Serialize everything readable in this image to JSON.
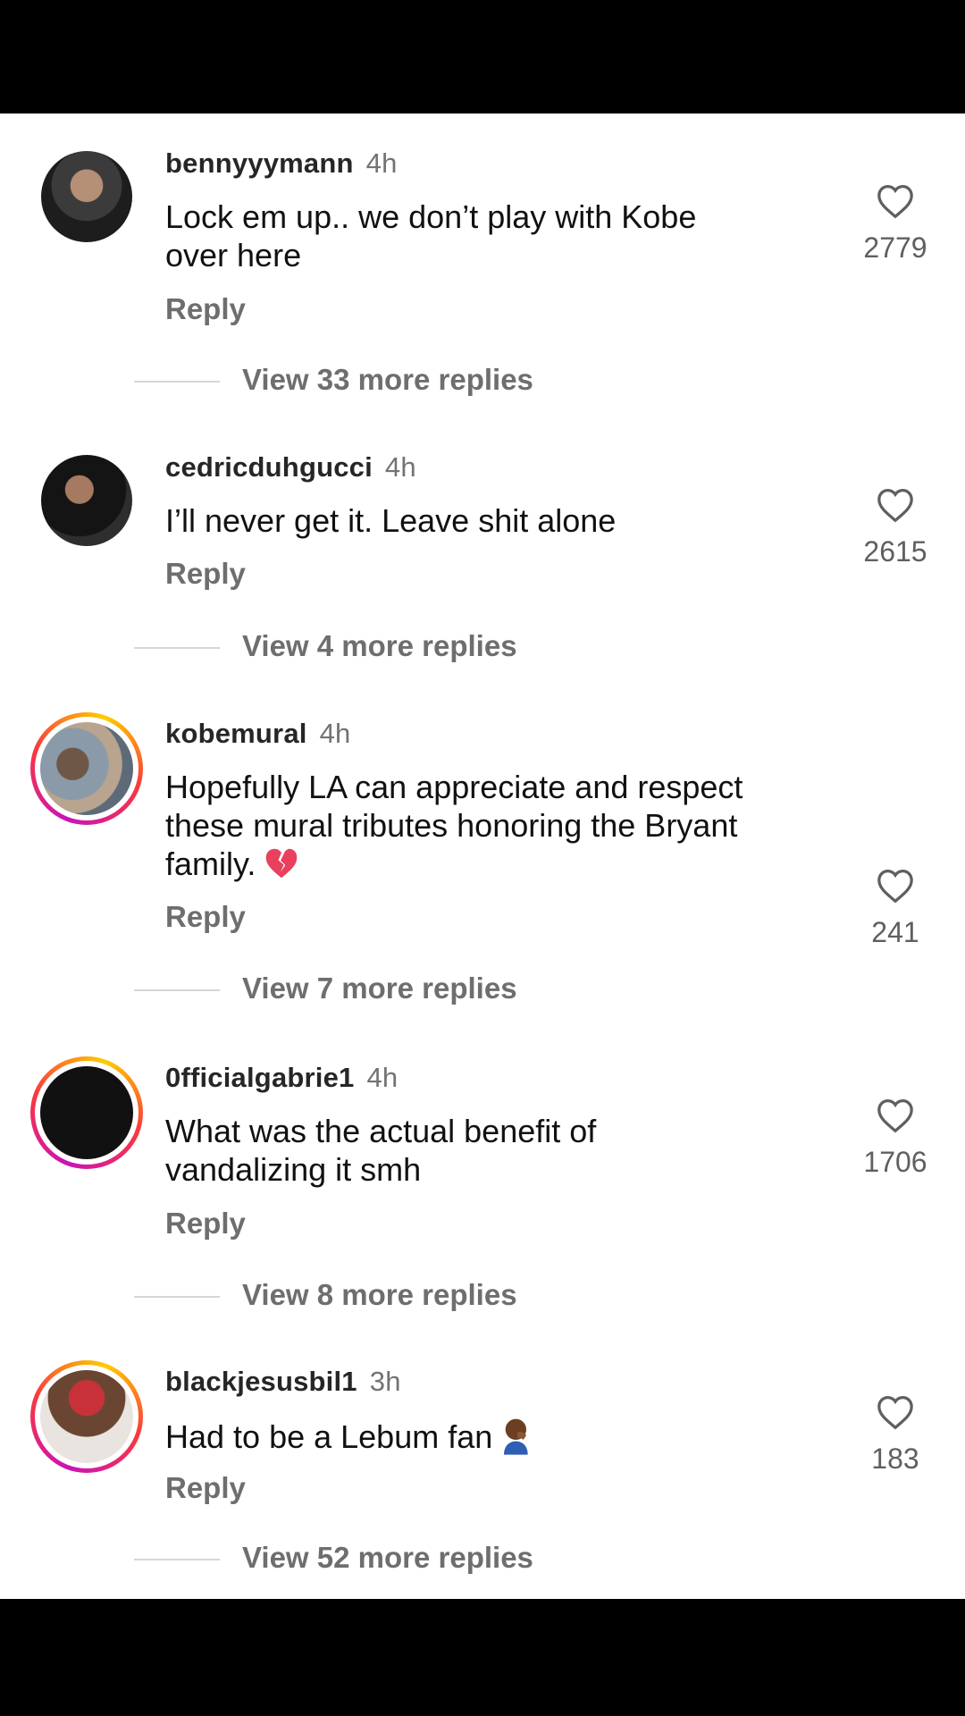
{
  "comments": [
    {
      "username": "bennyyymann",
      "time": "4h",
      "text_lines": [
        "Lock em up.. we don’t play with Kobe",
        "over here"
      ],
      "reply_label": "Reply",
      "likes": "2779",
      "view_more": "View 33 more replies",
      "story_ring": false
    },
    {
      "username": "cedricduhgucci",
      "time": "4h",
      "text_lines": [
        "I’ll never get it. Leave shit alone"
      ],
      "reply_label": "Reply",
      "likes": "2615",
      "view_more": "View 4 more replies",
      "story_ring": false
    },
    {
      "username": "kobemural",
      "time": "4h",
      "text_lines": [
        "Hopefully LA can appreciate and respect",
        "these mural tributes honoring the Bryant",
        "family."
      ],
      "emoji": "broken-heart",
      "reply_label": "Reply",
      "likes": "241",
      "view_more": "View 7 more replies",
      "story_ring": true
    },
    {
      "username": "0fficialgabrie1",
      "time": "4h",
      "text_lines": [
        "What was the actual benefit of",
        "vandalizing it smh"
      ],
      "reply_label": "Reply",
      "likes": "1706",
      "view_more": "View 8 more replies",
      "story_ring": true
    },
    {
      "username": "blackjesusbil1",
      "time": "3h",
      "text_lines": [
        "Had to be a Lebum fan"
      ],
      "emoji": "person-facepalming",
      "reply_label": "Reply",
      "likes": "183",
      "view_more": "View 52 more replies",
      "story_ring": true
    }
  ],
  "icons": {
    "like": "heart-outline-icon"
  },
  "colors": {
    "ring_start": "#c913b9",
    "ring_mid": "#f9373f",
    "ring_end": "#fecd00",
    "secondary_text": "#737373"
  }
}
